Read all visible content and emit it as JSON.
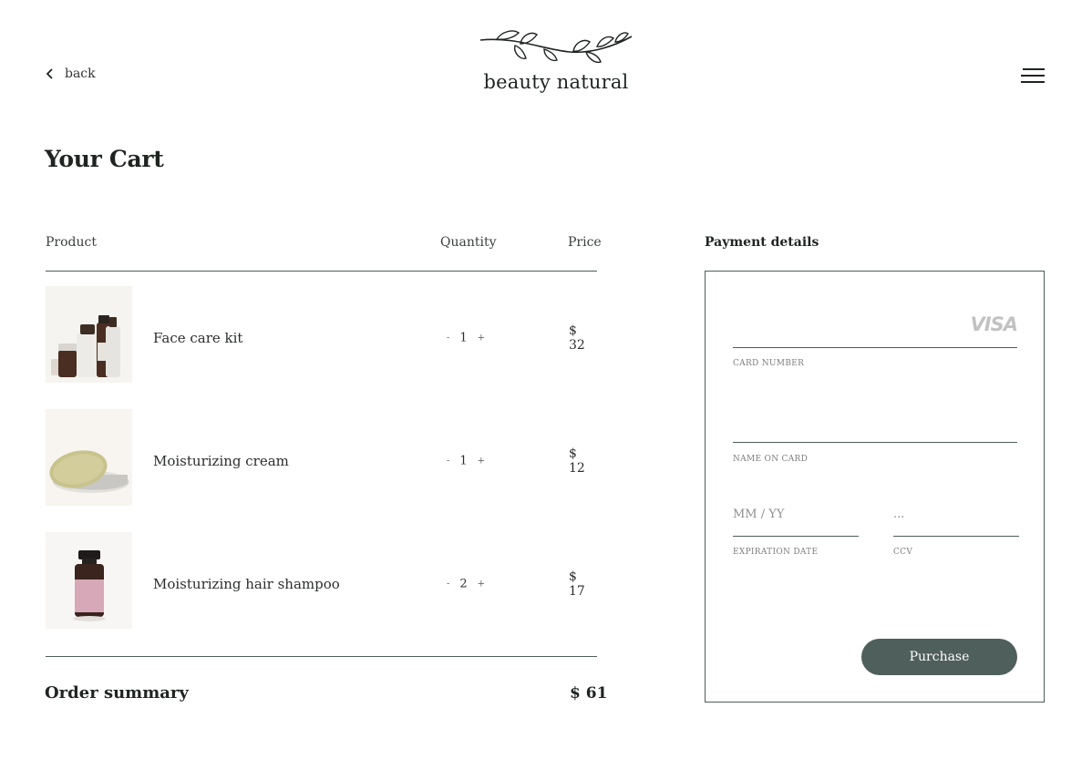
{
  "nav": {
    "back_label": "back",
    "brand": "beauty natural"
  },
  "cart": {
    "title": "Your Cart",
    "headers": {
      "product": "Product",
      "quantity": "Quantity",
      "price": "Price"
    },
    "items": [
      {
        "name": "Face care kit",
        "qty": "1",
        "price": "$ 32",
        "minus": "-",
        "plus": "+"
      },
      {
        "name": "Moisturizing cream",
        "qty": "1",
        "price": "$ 12",
        "minus": "-",
        "plus": "+"
      },
      {
        "name": "Moisturizing hair shampoo",
        "qty": "2",
        "price": "$ 17",
        "minus": "-",
        "plus": "+"
      }
    ],
    "summary_label": "Order summary",
    "summary_total": "$ 61"
  },
  "payment": {
    "title": "Payment details",
    "card_brand": "VISA",
    "card_number_label": "CARD NUMBER",
    "name_label": "NAME ON CARD",
    "expiry_placeholder": "MM / YY",
    "expiry_label": "EXPIRATION DATE",
    "ccv_placeholder": "...",
    "ccv_label": "CCV",
    "purchase_label": "Purchase"
  },
  "colors": {
    "accent": "#4f5f5b",
    "line": "#4d5e59",
    "text": "#1f2421"
  }
}
